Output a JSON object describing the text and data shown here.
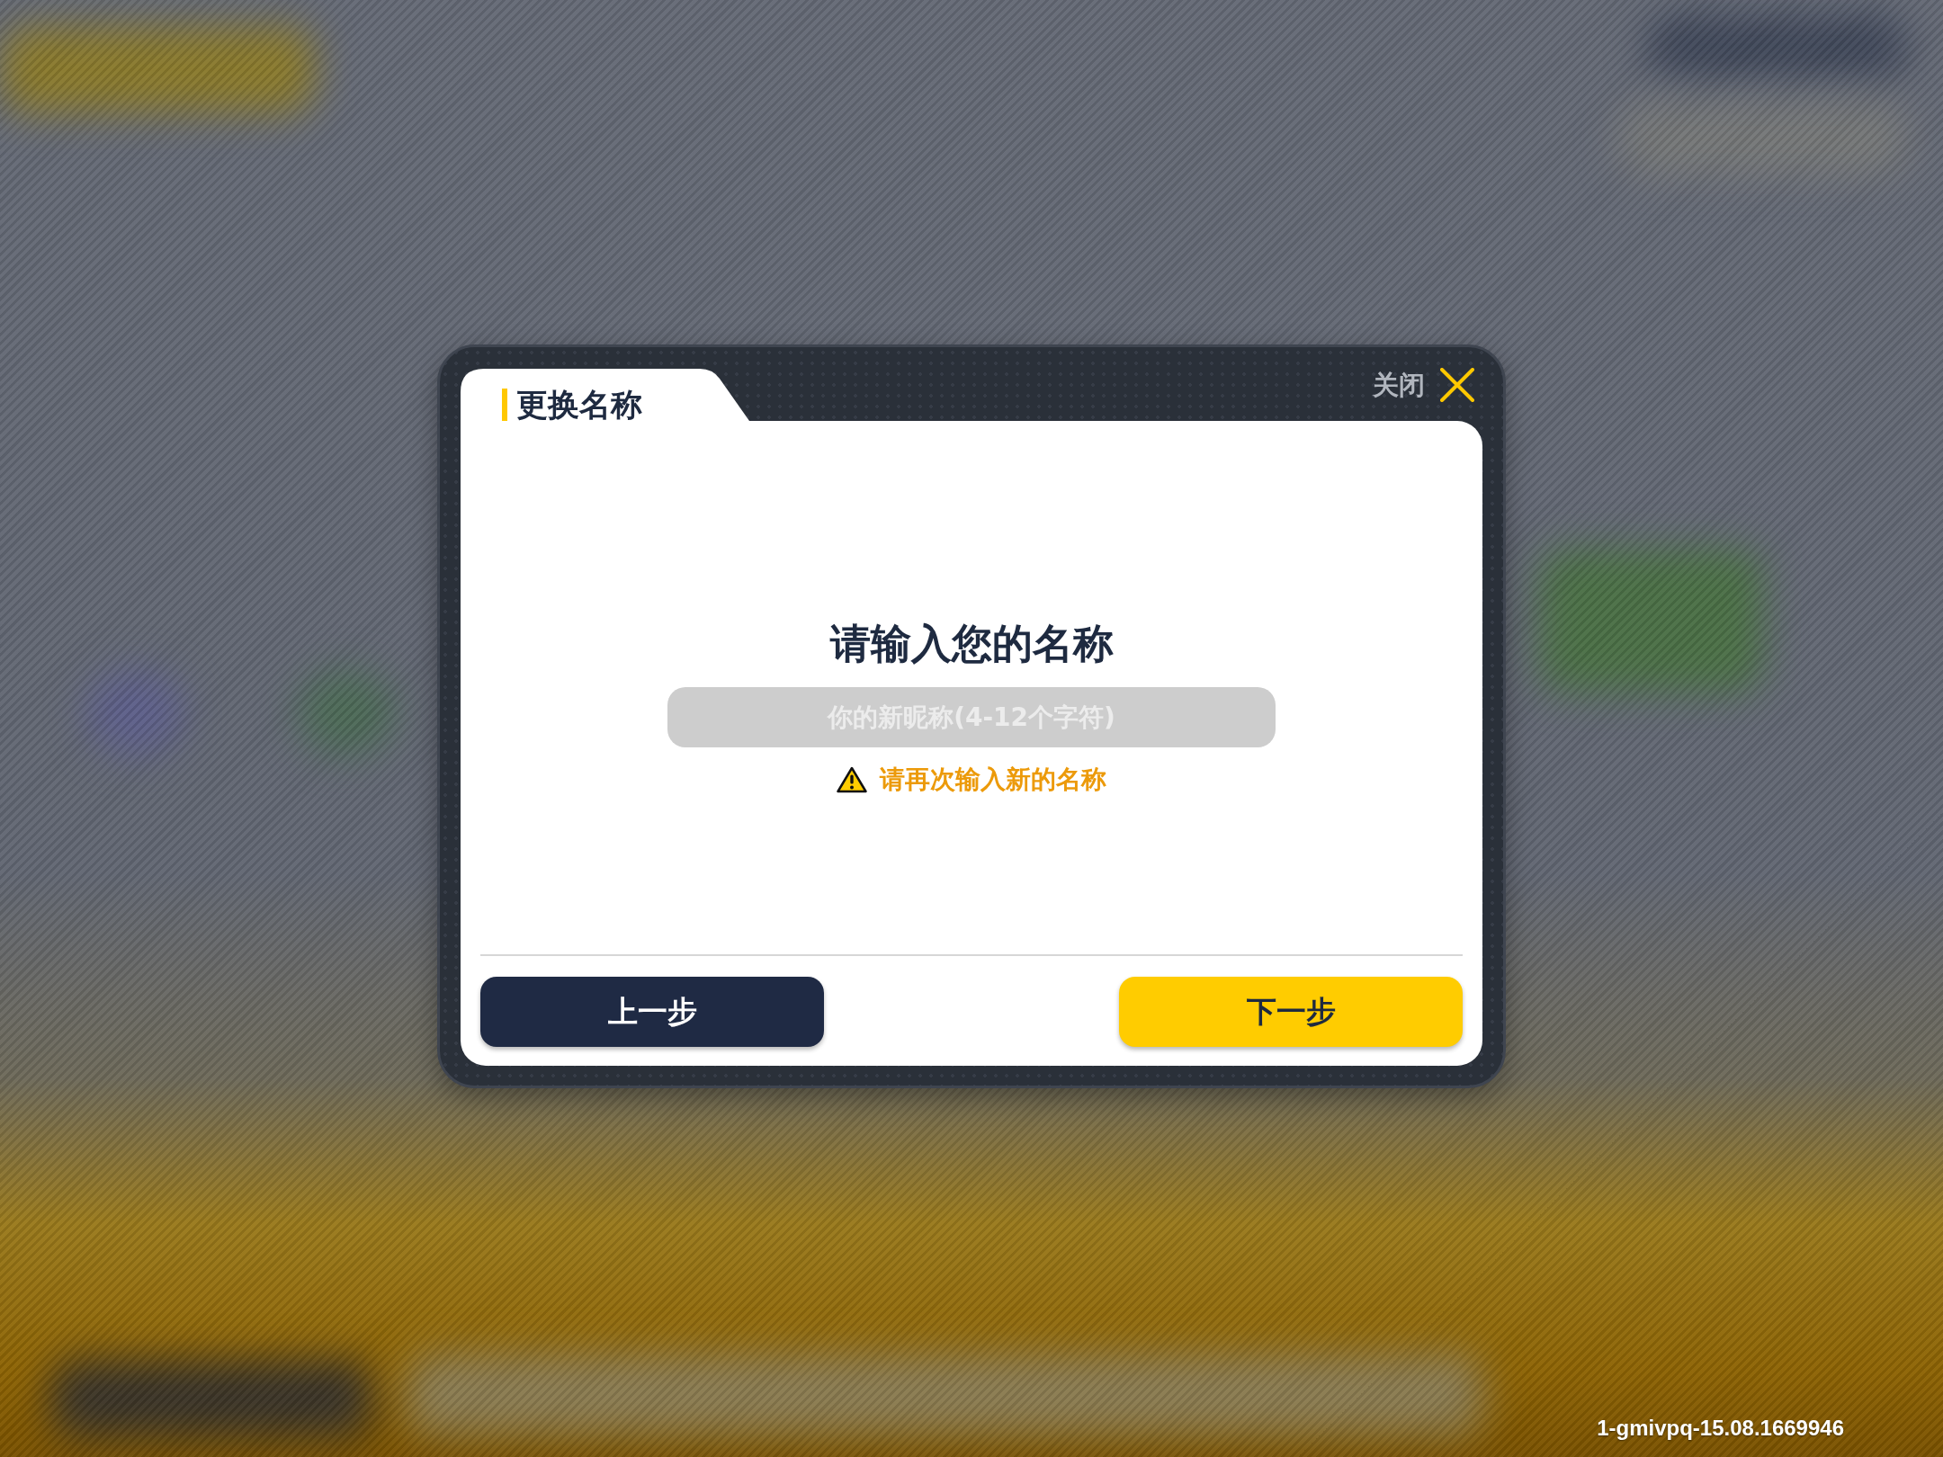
{
  "dialog": {
    "title": "更换名称",
    "close_label": "关闭",
    "prompt": "请输入您的名称",
    "name_input": {
      "placeholder": "你的新昵称(4-12个字符)"
    },
    "warning": "请再次输入新的名称",
    "buttons": [
      {
        "label": "上一步",
        "kind": "secondary"
      },
      {
        "label": "下一步",
        "kind": "primary"
      }
    ]
  },
  "version_label": "1-gmivpq-15.08.1669946"
}
